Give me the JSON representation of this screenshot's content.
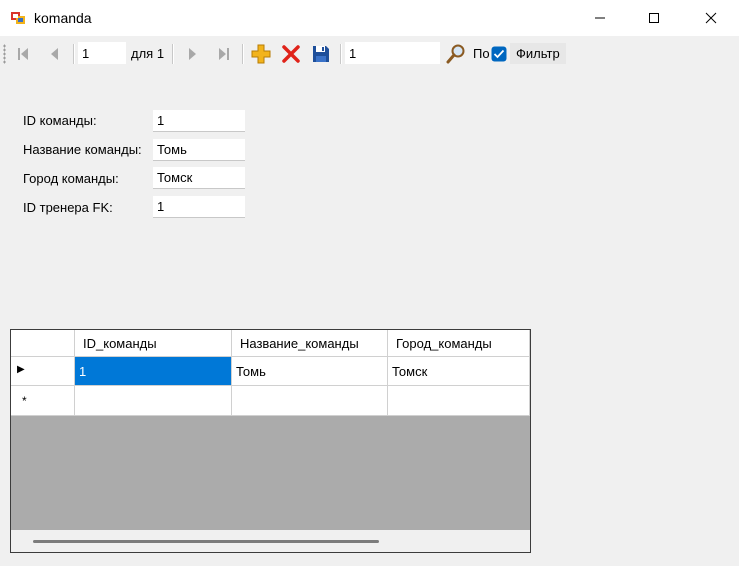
{
  "window": {
    "title": "komanda"
  },
  "toolbar": {
    "position_value": "1",
    "count_label": "для 1",
    "search_value": "1",
    "search_button_label": "По",
    "filter_checked": true,
    "filter_label": "Фильтр"
  },
  "form": {
    "fields": [
      {
        "label": "ID команды:",
        "value": "1"
      },
      {
        "label": "Название команды:",
        "value": "Томь"
      },
      {
        "label": "Город команды:",
        "value": "Томск"
      },
      {
        "label": "ID тренера FK:",
        "value": "1"
      }
    ]
  },
  "grid": {
    "columns": [
      "ID_команды",
      "Название_команды",
      "Город_команды"
    ],
    "rows": [
      [
        "1",
        "Томь",
        "Томск"
      ]
    ],
    "current_row_marker": "▶",
    "new_row_marker": "*"
  },
  "colors": {
    "selection": "#0078d7",
    "add_icon": "#f2b31b",
    "delete_icon": "#e0231a",
    "save_icon": "#1e4f9a"
  },
  "icons": [
    "app-icon",
    "first-record-icon",
    "prev-record-icon",
    "next-record-icon",
    "last-record-icon",
    "add-icon",
    "delete-icon",
    "save-icon",
    "search-icon",
    "checkbox-icon"
  ]
}
